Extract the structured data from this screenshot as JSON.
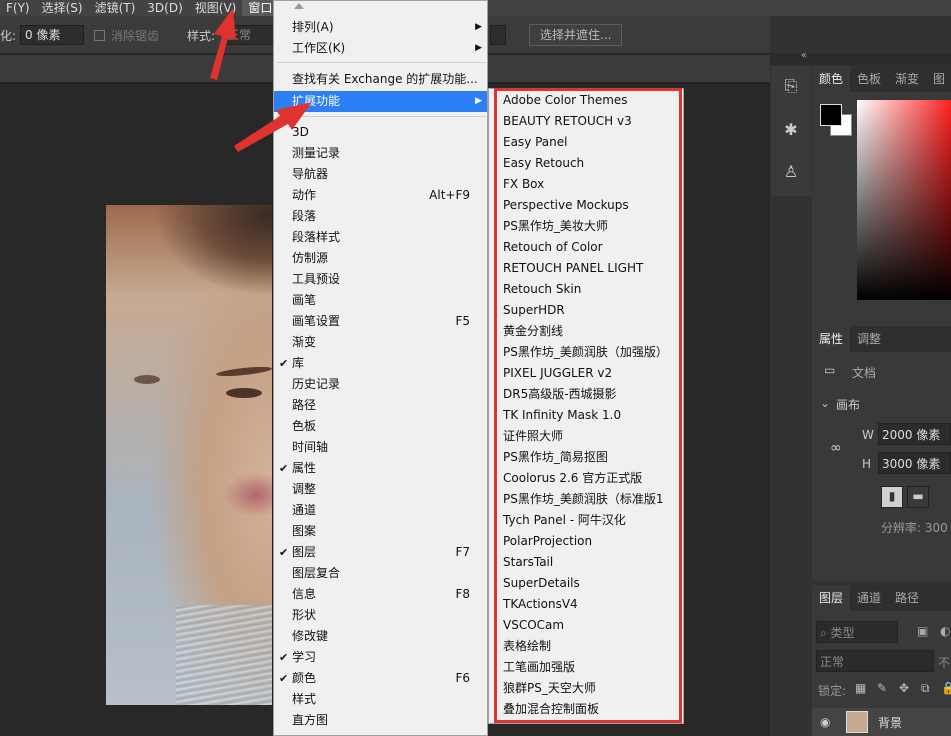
{
  "menubar": {
    "items": [
      "F(Y)",
      "选择(S)",
      "滤镜(T)",
      "3D(D)",
      "视图(V)",
      "窗口(W)"
    ]
  },
  "options": {
    "feather_label": "化:",
    "feather_value": "0 像素",
    "antialias_label": "消除锯齿",
    "style_label": "样式:",
    "style_value": "正常",
    "select_mask_label": "选择并遮住..."
  },
  "window_menu": {
    "items": [
      {
        "label": "排列(A)",
        "submenu": true
      },
      {
        "label": "工作区(K)",
        "submenu": true
      },
      {
        "label": "查找有关 Exchange 的扩展功能..."
      },
      {
        "label": "扩展功能",
        "submenu": true,
        "highlighted": true
      },
      {
        "label": "3D"
      },
      {
        "label": "测量记录"
      },
      {
        "label": "导航器"
      },
      {
        "label": "动作",
        "shortcut": "Alt+F9"
      },
      {
        "label": "段落"
      },
      {
        "label": "段落样式"
      },
      {
        "label": "仿制源"
      },
      {
        "label": "工具预设"
      },
      {
        "label": "画笔"
      },
      {
        "label": "画笔设置",
        "shortcut": "F5"
      },
      {
        "label": "渐变"
      },
      {
        "label": "库",
        "checked": true
      },
      {
        "label": "历史记录"
      },
      {
        "label": "路径"
      },
      {
        "label": "色板"
      },
      {
        "label": "时间轴"
      },
      {
        "label": "属性",
        "checked": true
      },
      {
        "label": "调整"
      },
      {
        "label": "通道"
      },
      {
        "label": "图案"
      },
      {
        "label": "图层",
        "checked": true,
        "shortcut": "F7"
      },
      {
        "label": "图层复合"
      },
      {
        "label": "信息",
        "shortcut": "F8"
      },
      {
        "label": "形状"
      },
      {
        "label": "修改键"
      },
      {
        "label": "学习",
        "checked": true
      },
      {
        "label": "颜色",
        "checked": true,
        "shortcut": "F6"
      },
      {
        "label": "样式"
      },
      {
        "label": "直方图"
      }
    ],
    "check_glyph": "✔",
    "arrow_glyph": "▶"
  },
  "extensions_submenu": {
    "items": [
      "Adobe Color Themes",
      "BEAUTY RETOUCH v3",
      "Easy Panel",
      "Easy Retouch",
      "FX Box",
      "Perspective Mockups",
      "PS黑作坊_美妆大师",
      "Retouch of Color",
      "RETOUCH PANEL LIGHT",
      "Retouch Skin",
      "SuperHDR",
      "黄金分割线",
      "PS黑作坊_美颜润肤（加强版）",
      "PIXEL JUGGLER v2",
      "DR5高级版-西城摄影",
      "TK Infinity Mask 1.0",
      "证件照大师",
      "PS黑作坊_简易抠图",
      "Coolorus 2.6 官方正式版",
      "PS黑作坊_美颜润肤（标准版1",
      "Tych Panel - 阿牛汉化",
      "PolarProjection",
      "StarsTail",
      "SuperDetails",
      "TKActionsV4",
      "VSCOCam",
      "表格绘制",
      "工笔画加强版",
      "狼群PS_天空大师",
      "叠加混合控制面板"
    ]
  },
  "right_panels": {
    "collapse_glyph": "«",
    "color_tabs": [
      "颜色",
      "色板",
      "渐变",
      "图"
    ],
    "props_tabs": [
      "属性",
      "调整"
    ],
    "doc_label": "文档",
    "canvas_label": "画布",
    "width_label": "W",
    "width_value": "2000 像素",
    "height_label": "H",
    "height_value": "3000 像素",
    "resolution_label": "分辨率: 300",
    "layers_tabs": [
      "图层",
      "通道",
      "路径"
    ],
    "layer_filter": "类型",
    "blend_mode": "正常",
    "opacity_label": "不",
    "lock_label": "锁定:",
    "layer_name": "背景"
  },
  "colors": {
    "highlight": "#2d7ff5",
    "annotation_red": "#e0322f"
  }
}
